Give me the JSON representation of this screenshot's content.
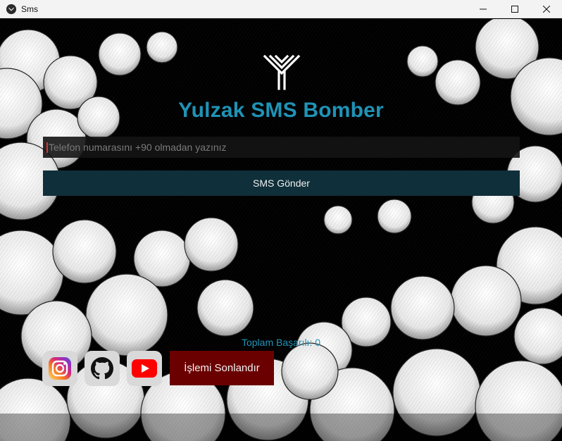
{
  "window": {
    "title": "Sms",
    "icon": "kivy-app-icon",
    "controls": [
      "minimize-icon",
      "maximize-icon",
      "close-icon"
    ]
  },
  "app": {
    "logo": "yulzak-logo",
    "title": "Yulzak SMS Bomber",
    "phone_input": {
      "value": "",
      "placeholder": "Telefon numarasını +90 olmadan yazınız"
    },
    "send_button_label": "SMS Gönder",
    "total_success_label": "Toplam Başarılı: 0",
    "social_buttons": [
      "instagram-icon",
      "github-icon",
      "youtube-icon"
    ],
    "terminate_button_label": "İşlemi Sonlandır"
  },
  "colors": {
    "accent": "#1f93b6",
    "send_button_bg": "#0f2f3a",
    "terminate_button_bg": "#6b0000",
    "background": "#000000"
  }
}
